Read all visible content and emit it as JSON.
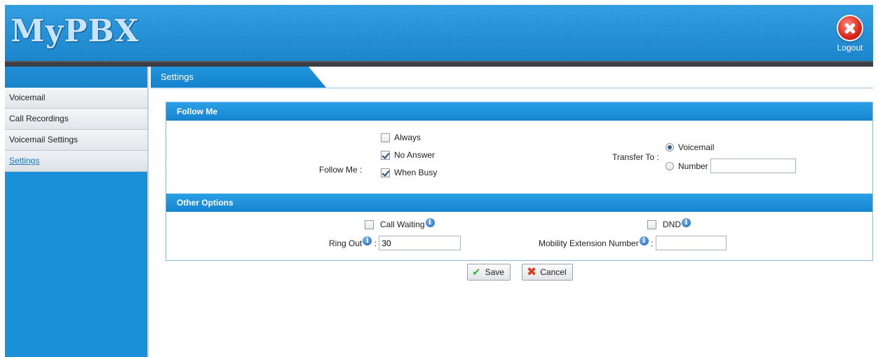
{
  "app": {
    "logo": "MyPBX",
    "logout_label": "Logout"
  },
  "sidebar": {
    "items": [
      {
        "label": "Voicemail",
        "active": false
      },
      {
        "label": "Call Recordings",
        "active": false
      },
      {
        "label": "Voicemail Settings",
        "active": false
      },
      {
        "label": "Settings",
        "active": true
      }
    ]
  },
  "tab": {
    "label": "Settings"
  },
  "follow_me": {
    "section_title": "Follow Me",
    "label": "Follow Me :",
    "options": [
      {
        "label": "Always",
        "checked": false
      },
      {
        "label": "No Answer",
        "checked": true
      },
      {
        "label": "When Busy",
        "checked": true
      }
    ],
    "transfer_label": "Transfer To :",
    "transfer_options": [
      {
        "label": "Voicemail",
        "selected": true
      },
      {
        "label": "Number",
        "selected": false
      }
    ],
    "number_value": ""
  },
  "other_options": {
    "section_title": "Other Options",
    "call_waiting_label": "Call Waiting",
    "call_waiting_checked": false,
    "dnd_label": "DND",
    "dnd_checked": false,
    "ring_out_label": "Ring Out",
    "ring_out_value": "30",
    "mobility_label": "Mobility Extension Number",
    "mobility_value": ""
  },
  "actions": {
    "save_label": "Save",
    "cancel_label": "Cancel"
  },
  "icons": {
    "logout": "close-circle-icon",
    "info": "info-icon",
    "save": "check-icon",
    "cancel": "x-icon"
  }
}
